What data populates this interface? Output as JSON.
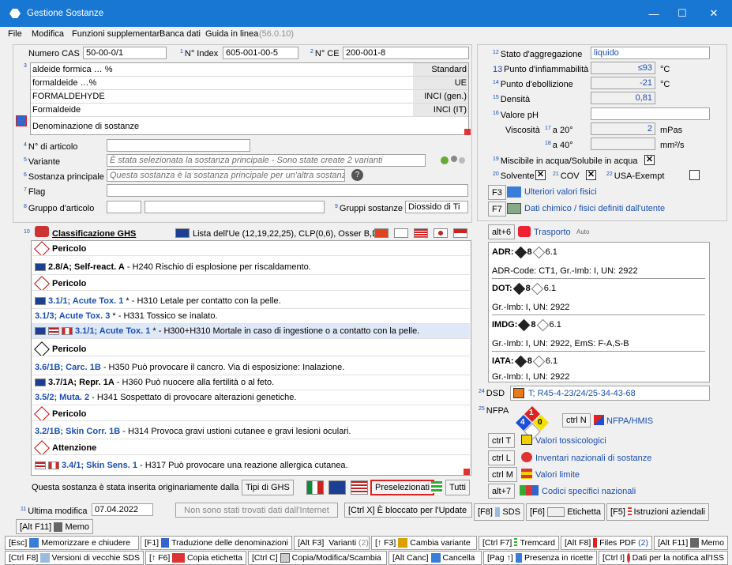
{
  "window": {
    "title": "Gestione Sostanze",
    "minimize": "—",
    "maximize": "☐",
    "close": "✕"
  },
  "menu": [
    "File",
    "Modifica",
    "Funzioni supplementari",
    "Banca dati",
    "Guida in linea",
    "(56.0.10)"
  ],
  "header": {
    "cas_label": "Numero CAS",
    "cas_value": "50-00-0/1",
    "index_label": "N° Index",
    "index_value": "605-001-00-5",
    "ce_label": "N° CE",
    "ce_value": "200-001-8"
  },
  "names": [
    {
      "name": "aldeide formica … %",
      "type": "Standard"
    },
    {
      "name": "formaldeide …%",
      "type": "UE"
    },
    {
      "name": "FORMALDEHYDE",
      "type": "INCI (gen.)"
    },
    {
      "name": "Formaldeide",
      "type": "INCI (IT)"
    },
    {
      "name": "Denominazione di sostanze",
      "type": ""
    }
  ],
  "article": {
    "art_label": "N° di articolo",
    "variant_label": "Variante",
    "variant_value": "È stata selezionata la sostanza principale - Sono state create 2 varianti",
    "main_label": "Sostanza principale",
    "main_value": "Questa sostanza è la sostanza principale per un'altra sostanza.",
    "flag_label": "Flag",
    "group_label": "Gruppo d'articolo",
    "substgroups_label": "Gruppi sostanze",
    "substgroups_value": "Diossido di Ti"
  },
  "ghs": {
    "title": "Classificazione GHS",
    "list": "Lista dell'Ue (12,19,22,25), CLP(0,6), Osser B,D",
    "rows": [
      {
        "kind": "signal",
        "text": "Pericolo"
      },
      {
        "kind": "entry",
        "prefix": "2.8/A; Self-react. A",
        "desc": " - H240 Rischio di esplosione per riscaldamento."
      },
      {
        "kind": "signal",
        "text": "Pericolo"
      },
      {
        "kind": "entry",
        "prefix": "3.1/1; Acute Tox. 1",
        "desc": " * - H310 Letale per contatto con la pelle."
      },
      {
        "kind": "entry",
        "prefix": "3.1/3; Acute Tox. 3",
        "desc": " * - H331 Tossico se inalato."
      },
      {
        "kind": "entry",
        "prefix": "3.1/1; Acute Tox. 1",
        "desc": " * - H300+H310 Mortale in caso di ingestione o a contatto con la pelle."
      },
      {
        "kind": "signal",
        "text": "Pericolo"
      },
      {
        "kind": "entry",
        "prefix": "3.6/1B; Carc. 1B",
        "desc": " - H350 Può provocare il cancro. Via di esposizione: Inalazione."
      },
      {
        "kind": "entry",
        "prefix": "3.7/1A; Repr. 1A",
        "desc": " - H360 Può nuocere alla fertilità o al feto."
      },
      {
        "kind": "entry",
        "prefix": "3.5/2; Muta. 2",
        "desc": " - H341 Sospettato di provocare alterazioni genetiche."
      },
      {
        "kind": "signal",
        "text": "Pericolo"
      },
      {
        "kind": "entry",
        "prefix": "3.2/1B; Skin Corr. 1B",
        "desc": " - H314 Provoca gravi ustioni cutanee e gravi lesioni oculari."
      },
      {
        "kind": "signal",
        "text": "Attenzione"
      },
      {
        "kind": "entry",
        "prefix": "3.4/1; Skin Sens. 1",
        "desc": " - H317 Può provocare una reazione allergica cutanea."
      }
    ],
    "inserted": "Questa sostanza è stata inserita originariamente dalla DR-So",
    "btn_tipi": "Tipi di GHS",
    "btn_presel": "Preselezionati",
    "btn_tutti": "Tutti"
  },
  "footer_left": {
    "mod_label": "Ultima modifica",
    "mod_value": "07.04.2022",
    "internet": "Non sono stati trovati dati dall'Internet",
    "blocked": "[Ctrl X] È bloccato per l'Update",
    "memo": "[Alt F11]",
    "memo_label": "Memo"
  },
  "phys": {
    "state_label": "Stato d'aggregazione",
    "state_value": "liquido",
    "flash_label": "Punto d'infiammabilità",
    "flash_value": "≤93",
    "flash_unit": "°C",
    "boil_label": "Punto d'ebollizione",
    "boil_value": "-21",
    "boil_unit": "°C",
    "dens_label": "Densità",
    "dens_value": "0,81",
    "ph_label": "Valore pH",
    "visc_label": "Viscosità",
    "visc20": "a 20°",
    "visc20_value": "2",
    "visc20_unit": "mPas",
    "visc40": "a 40°",
    "visc40_unit": "mm²/s",
    "misc_label": "Miscibile in acqua/Solubile in acqua",
    "solv_label": "Solvente",
    "cov_label": "COV",
    "usa_label": "USA-Exempt",
    "f3": "F3",
    "f3_label": "Ulteriori valori fisici",
    "f7": "F7",
    "f7_label": "Dati chimico / fisici definiti dall'utente"
  },
  "transport": {
    "key": "alt+6",
    "title": "Trasporto",
    "auto": "Auto",
    "items": [
      {
        "code": "ADR:",
        "c1": "8",
        "c2": "6.1",
        "detail": "ADR-Code: CT1, Gr.-Imb: I, UN: 2922"
      },
      {
        "code": "DOT:",
        "c1": "8",
        "c2": "6.1",
        "detail": "Gr.-Imb: I, UN: 2922"
      },
      {
        "code": "IMDG:",
        "c1": "8",
        "c2": "6.1",
        "detail": "Gr.-Imb: I, UN: 2922, EmS: F-A,S-B"
      },
      {
        "code": "IATA:",
        "c1": "8",
        "c2": "6.1",
        "detail": "Gr.-Imb: I, UN: 2922"
      }
    ]
  },
  "dsd": {
    "label": "DSD",
    "value": "T; R45-4-23/24/25-34-43-68"
  },
  "nfpa": {
    "label": "NFPA",
    "health": "4",
    "fire": "1",
    "react": "0",
    "btn": "ctrl N",
    "btn_label": "NFPA/HMIS"
  },
  "links": [
    {
      "key": "ctrl T",
      "label": "Valori tossicologici"
    },
    {
      "key": "ctrl L",
      "label": "Inventari nazionali di sostanze"
    },
    {
      "key": "ctrl M",
      "label": "Valori limite"
    },
    {
      "key": "alt+7",
      "label": "Codici specifici nazionali"
    }
  ],
  "docbtns": [
    {
      "key": "[F8]",
      "label": "SDS"
    },
    {
      "key": "[F6]",
      "label": "Etichetta"
    },
    {
      "key": "[F5]",
      "label": "Istruzioni aziendali"
    }
  ],
  "toolbar1": [
    {
      "key": "[Esc]",
      "label": "Memorizzare e chiudere"
    },
    {
      "key": "[F1]",
      "label": "Traduzione delle denominazioni"
    },
    {
      "key": "[Alt F3]",
      "label": "Varianti",
      "extra": "(2)"
    },
    {
      "key": "[↑ F3]",
      "label": "Cambia variante"
    },
    {
      "key": "[Ctrl F7]",
      "label": "Tremcard"
    },
    {
      "key": "[Alt F8]",
      "label": "Files PDF",
      "extra": "(2)"
    },
    {
      "key": "[Alt F11]",
      "label": "Memo"
    }
  ],
  "toolbar2": [
    {
      "key": "[Ctrl F8]",
      "label": "Versioni di vecchie SDS"
    },
    {
      "key": "[↑ F6]",
      "label": "Copia etichetta"
    },
    {
      "key": "[Ctrl C]",
      "label": "Copia/Modifica/Scambia"
    },
    {
      "key": "[Alt Canc]",
      "label": "Cancella"
    },
    {
      "key": "[Pag ↑]",
      "label": "Presenza in ricette"
    },
    {
      "key": "[Ctrl I]",
      "label": "Dati per la notifica all'ISS"
    }
  ]
}
